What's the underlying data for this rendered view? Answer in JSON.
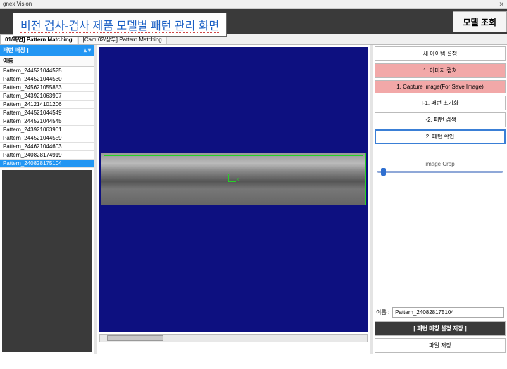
{
  "window": {
    "title": "gnex Vision",
    "close": "✕"
  },
  "banner": {
    "text": "비전 검사-검사 제품 모델별 패턴 관리 화면"
  },
  "header": {
    "model_btn": "모델 조회"
  },
  "tabs": {
    "main": "01/측면] Pattern Matching",
    "sub": "[Cam 02/상부] Pattern Matching"
  },
  "left": {
    "title": "패턴 매칭 ]",
    "arrow_up": "▴",
    "arrow_down": "▾",
    "col": "이름",
    "items": [
      "Pattern_244521044525",
      "Pattern_244521044530",
      "Pattern_245621055853",
      "Pattern_243921063907",
      "Pattern_241214101206",
      "Pattern_244521044549",
      "Pattern_244521044545",
      "Pattern_243921063901",
      "Pattern_244521044559",
      "Pattern_244621044603",
      "Pattern_240828174919",
      "Pattern_240828175104"
    ],
    "selected_index": 11
  },
  "center": {
    "axis_label": "x"
  },
  "right": {
    "btns": {
      "new_item": "새 아이템 설정",
      "img_capture": "1. 이미지 캡쳐",
      "img_capture_save": "1. Capture image(For Save Image)",
      "pattern_init": "I-1. 패턴 초기화",
      "pattern_search": "I-2. 패턴 검색",
      "pattern_confirm": "2. 패턴 확인"
    },
    "crop_label": "image Crop",
    "name_label": "이름 :",
    "name_value": "Pattern_240828175104",
    "save_pattern": "[ 패턴 매칭 설정 저장 ]",
    "save_file": "파일 저장"
  },
  "colors": {
    "accent_blue": "#2296f3",
    "nav_bg": "#0d1080",
    "roi_green": "#25d325",
    "pink_btn": "#f2a8a8",
    "dark": "#3a3a3a"
  }
}
